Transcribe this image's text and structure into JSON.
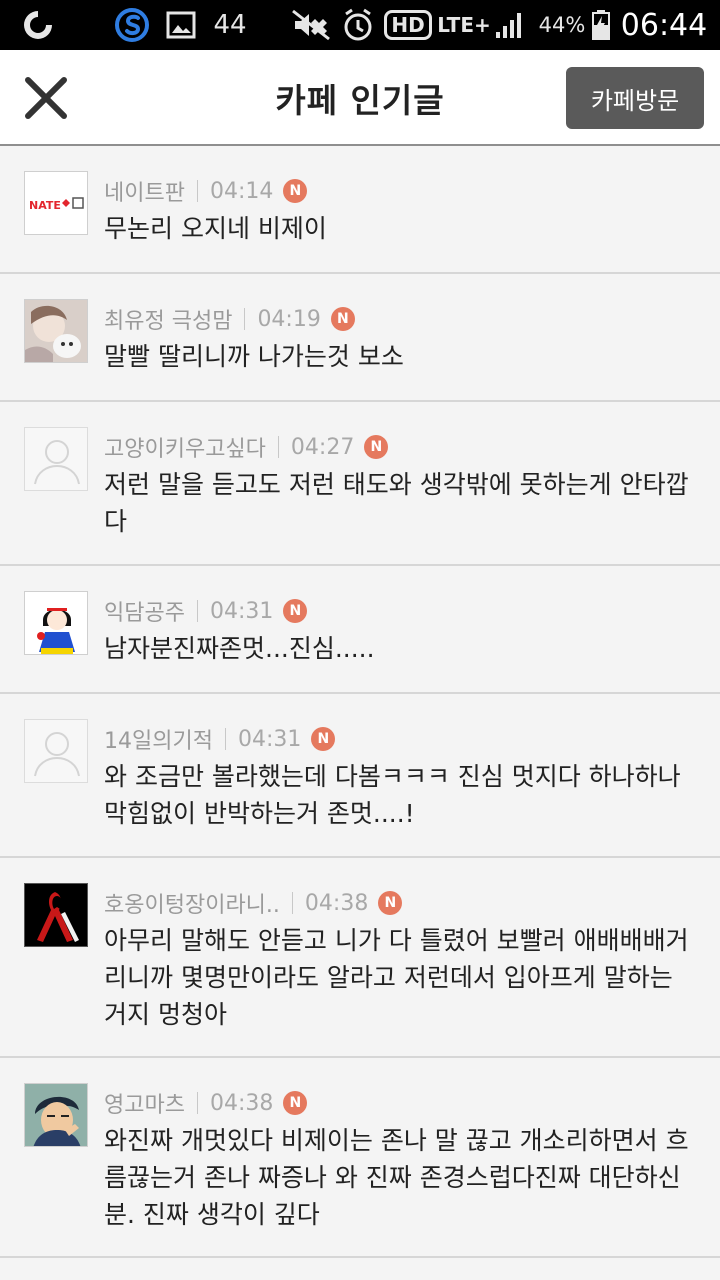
{
  "status_bar": {
    "notification_count": "44",
    "battery_percent": "44%",
    "time": "06:44",
    "network_label": "LTE+",
    "hd_label": "HD"
  },
  "header": {
    "title": "카페 인기글",
    "visit_button": "카페방문"
  },
  "posts": [
    {
      "author": "네이트판",
      "time": "04:14",
      "badge": "N",
      "text": "무논리 오지네 비제이",
      "avatar": "nate-logo"
    },
    {
      "author": "최유정 극성맘",
      "time": "04:19",
      "badge": "N",
      "text": "말빨 딸리니까 나가는것 보소",
      "avatar": "photo"
    },
    {
      "author": "고양이키우고싶다",
      "time": "04:27",
      "badge": "N",
      "text": "저런 말을 듣고도 저런 태도와 생각밖에 못하는게 안타깝다",
      "avatar": "default"
    },
    {
      "author": "익담공주",
      "time": "04:31",
      "badge": "N",
      "text": "남자분진짜존멋...진심.....",
      "avatar": "snow-white"
    },
    {
      "author": "14일의기적",
      "time": "04:31",
      "badge": "N",
      "text": "와 조금만 볼라했는데 다봄ㅋㅋㅋ 진심 멋지다 하나하나 막힘없이 반박하는거 존멋....!",
      "avatar": "default"
    },
    {
      "author": "호옹이텅장이라니..",
      "time": "04:38",
      "badge": "N",
      "text": "아무리 말해도 안듣고 니가 다 틀렸어 보빨러 애배배배거리니까 몇명만이라도 알라고 저런데서 입아프게 말하는거지 멍청아",
      "avatar": "ribbon"
    },
    {
      "author": "영고마츠",
      "time": "04:38",
      "badge": "N",
      "text": "와진짜 개멋있다 비제이는 존나 말 끊고 개소리하면서 흐름끊는거 존나 짜증나 와 진짜 존경스럽다진짜 대단하신분. 진짜 생각이 깊다",
      "avatar": "anime"
    }
  ]
}
